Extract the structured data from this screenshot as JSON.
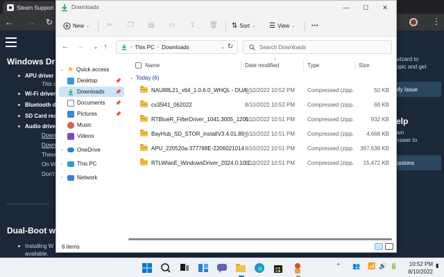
{
  "browser": {
    "tab_title": "Steam Support",
    "page": {
      "heading_1": "Windows Drive",
      "items": [
        {
          "text": "APU driver",
          "style": "b"
        },
        {
          "text": "This c",
          "style": "i"
        },
        {
          "text": "Wi-Fi driver",
          "style": "b"
        },
        {
          "text": "Bluetooth d",
          "style": "b"
        },
        {
          "text": "SD Card rea",
          "style": "b"
        },
        {
          "text": "Audio driver",
          "style": "b"
        },
        {
          "text": "Down",
          "style": "u"
        },
        {
          "text": "Down",
          "style": "u"
        },
        {
          "text": "These",
          "style": ""
        },
        {
          "text": "On W",
          "style": ""
        },
        {
          "text": "Don't",
          "style": ""
        }
      ],
      "heading_2": "Dual-Boot wi",
      "bottom_item_1": "Installing W",
      "bottom_item_2": "available.",
      "right_text_1": "wizard to",
      "right_text_2": "opic and get",
      "right_button_1": "My Issue",
      "right_heading": "elp",
      "right_text_3": "am",
      "right_text_4": "nswer to",
      "right_button_2": "ussions"
    }
  },
  "explorer": {
    "title": "Downloads",
    "window_controls": {
      "minimize": "—",
      "maximize": "☐",
      "close": "✕"
    },
    "toolbar": {
      "new_label": "New",
      "sort_label": "Sort",
      "view_label": "View",
      "more_label": "•••"
    },
    "address": {
      "segments": [
        "This PC",
        "Downloads"
      ]
    },
    "search": {
      "placeholder": "Search Downloads"
    },
    "nav": {
      "quick_access": "Quick access",
      "items": [
        {
          "label": "Desktop",
          "icon": "desktop-icon",
          "color": "#3a96dd"
        },
        {
          "label": "Downloads",
          "icon": "downloads-icon",
          "color": "#1a9e5a"
        },
        {
          "label": "Documents",
          "icon": "documents-icon",
          "color": "#6b7b8c"
        },
        {
          "label": "Pictures",
          "icon": "pictures-icon",
          "color": "#3a8ad6"
        },
        {
          "label": "Music",
          "icon": "music-icon",
          "color": "#e35a4a"
        },
        {
          "label": "Videos",
          "icon": "videos-icon",
          "color": "#7a4ac6"
        }
      ],
      "onedrive": "OneDrive",
      "this_pc": "This PC",
      "network": "Network"
    },
    "columns": {
      "name": "Name",
      "date": "Date modified",
      "type": "Type",
      "size": "Size"
    },
    "group_label": "Today (6)",
    "files": [
      {
        "name": "NAU88L21_x64_1.0.6.0_WHQL - DUA_...",
        "date": "8/10/2022 10:52 PM",
        "type": "Compressed (zipp...",
        "size": "50 KB"
      },
      {
        "name": "cs35l41_062022",
        "date": "8/10/2022 10:52 PM",
        "type": "Compressed (zipp...",
        "size": "69 KB"
      },
      {
        "name": "RTBlueR_FilterDriver_1041.3005_1201...",
        "date": "8/10/2022 10:51 PM",
        "type": "Compressed (zipp...",
        "size": "932 KB"
      },
      {
        "name": "BayHub_SD_STOR_installV3.4.01.89_W...",
        "date": "8/10/2022 10:51 PM",
        "type": "Compressed (zipp...",
        "size": "4,668 KB"
      },
      {
        "name": "APU_220520a-377788E-2206021014",
        "date": "8/10/2022 10:51 PM",
        "type": "Compressed (zipp...",
        "size": "397,638 KB"
      },
      {
        "name": "RTLWlanE_WindowsDriver_2024.0.10.1...",
        "date": "8/10/2022 10:51 PM",
        "type": "Compressed (zipp...",
        "size": "15,472 KB"
      }
    ],
    "status": "6 items"
  },
  "taskbar": {
    "time": "10:52 PM",
    "date": "8/10/2022"
  },
  "colors": {
    "accent": "#0067c0",
    "folder": "#f3c14b",
    "selection": "#cce4f7",
    "steam_bg": "#1b2838"
  }
}
